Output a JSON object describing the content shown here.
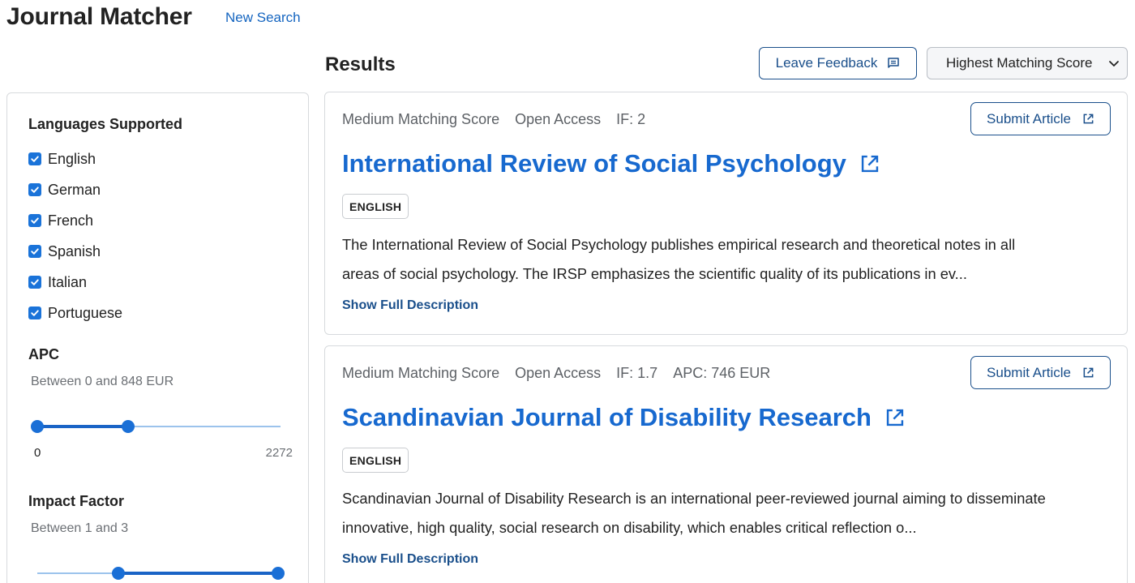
{
  "header": {
    "app_title": "Journal Matcher",
    "new_search": "New Search"
  },
  "results": {
    "title": "Results",
    "feedback_label": "Leave Feedback",
    "sort_selected": "Highest Matching Score"
  },
  "filters": {
    "languages": {
      "heading": "Languages Supported",
      "items": [
        {
          "label": "English",
          "checked": true
        },
        {
          "label": "German",
          "checked": true
        },
        {
          "label": "French",
          "checked": true
        },
        {
          "label": "Spanish",
          "checked": true
        },
        {
          "label": "Italian",
          "checked": true
        },
        {
          "label": "Portuguese",
          "checked": true
        }
      ]
    },
    "apc": {
      "heading": "APC",
      "range_text": "Between 0 and 848 EUR",
      "min_label": "0",
      "max_label": "2272",
      "value_low": 0,
      "value_high": 848,
      "scale_min": 0,
      "scale_max": 2272
    },
    "impact_factor": {
      "heading": "Impact Factor",
      "range_text": "Between 1 and 3",
      "value_low": 1,
      "value_high": 3
    }
  },
  "journals": [
    {
      "matching": "Medium Matching Score",
      "access": "Open Access",
      "if": "IF: 2",
      "apc": "",
      "submit_label": "Submit Article",
      "title": "International Review of Social Psychology",
      "language_badge": "ENGLISH",
      "description_line1": "The International Review of Social Psychology publishes empirical research and theoretical notes in all",
      "description_line2": "areas of social psychology. The IRSP emphasizes the scientific quality of its publications in ev...",
      "show_full": "Show Full Description"
    },
    {
      "matching": "Medium Matching Score",
      "access": "Open Access",
      "if": "IF: 1.7",
      "apc": "APC: 746 EUR",
      "submit_label": "Submit Article",
      "title": "Scandinavian Journal of Disability Research",
      "language_badge": "ENGLISH",
      "description_line1": "Scandinavian Journal of Disability Research is an international peer-reviewed journal aiming to disseminate",
      "description_line2": "innovative, high quality, social research on disability, which enables critical reflection o...",
      "show_full": "Show Full Description"
    }
  ],
  "colors": {
    "accent": "#1a73d9",
    "title_link": "#1769cf",
    "button_border": "#1a4f8b"
  }
}
